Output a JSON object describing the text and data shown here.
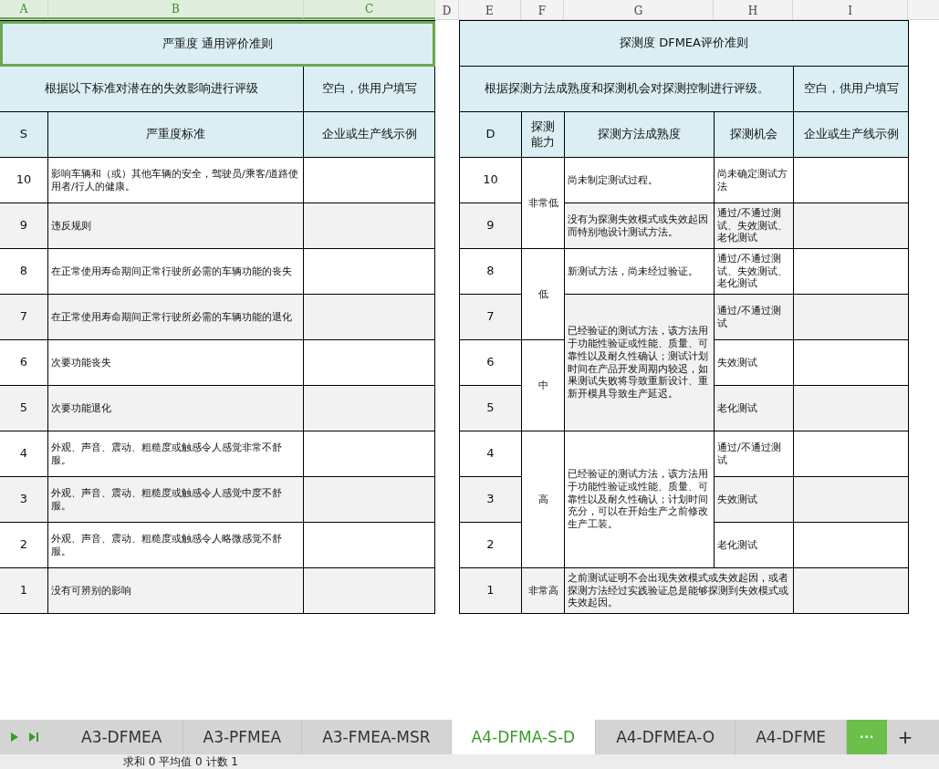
{
  "column_headers": [
    {
      "label": "A",
      "selected": true
    },
    {
      "label": "B",
      "selected": true
    },
    {
      "label": "C",
      "selected": true
    },
    {
      "label": "D",
      "selected": false
    },
    {
      "label": "E",
      "selected": false
    },
    {
      "label": "F",
      "selected": false
    },
    {
      "label": "G",
      "selected": false
    },
    {
      "label": "H",
      "selected": false
    },
    {
      "label": "I",
      "selected": false
    }
  ],
  "severity_table": {
    "title": "严重度 通用评价准则",
    "title_selected": true,
    "subtitle": "根据以下标准对潜在的失效影响进行评级",
    "note": "空白，供用户填写",
    "columns": [
      "S",
      "严重度标准",
      "企业或生产线示例"
    ],
    "rows": [
      {
        "s": "10",
        "criteria": "影响车辆和（或）其他车辆的安全，驾驶员/乘客/道路使用者/行人的健康。"
      },
      {
        "s": "9",
        "criteria": "违反规则"
      },
      {
        "s": "8",
        "criteria": "在正常使用寿命期间正常行驶所必需的车辆功能的丧失"
      },
      {
        "s": "7",
        "criteria": "在正常使用寿命期间正常行驶所必需的车辆功能的退化"
      },
      {
        "s": "6",
        "criteria": "次要功能丧失"
      },
      {
        "s": "5",
        "criteria": "次要功能退化"
      },
      {
        "s": "4",
        "criteria": "外观、声音、震动、粗糙度或触感令人感觉非常不舒服。"
      },
      {
        "s": "3",
        "criteria": "外观、声音、震动、粗糙度或触感令人感觉中度不舒服。"
      },
      {
        "s": "2",
        "criteria": "外观、声音、震动、粗糙度或触感令人略微感觉不舒服。"
      },
      {
        "s": "1",
        "criteria": "没有可辨别的影响"
      }
    ]
  },
  "detection_table": {
    "title": "探测度 DFMEA评价准则",
    "subtitle": "根据探测方法成熟度和探测机会对探测控制进行评级。",
    "note": "空白，供用户填写",
    "columns": [
      "D",
      "探测能力",
      "探测方法成熟度",
      "探测机会",
      "企业或生产线示例"
    ],
    "rows": [
      {
        "d": "10",
        "ability": "非常低",
        "maturity": "尚未制定测试过程。",
        "opportunity": "尚未确定测试方法"
      },
      {
        "d": "9",
        "maturity": "没有为探测失效模式或失效起因而特别地设计测试方法。",
        "opportunity": "通过/不通过测试、失效测试、老化测试"
      },
      {
        "d": "8",
        "ability": "低",
        "maturity": "新测试方法，尚未经过验证。",
        "opportunity": "通过/不通过测试、失效测试、老化测试"
      },
      {
        "d": "7",
        "maturity": "已经验证的测试方法，该方法用于功能性验证或性能、质量、可靠性以及耐久性确认；测试计划时间在产品开发周期内较迟，如果测试失败将导致重新设计、重新开模具导致生产延迟。",
        "opportunity": "通过/不通过测试"
      },
      {
        "d": "6",
        "ability": "中",
        "opportunity": "失效测试"
      },
      {
        "d": "5",
        "opportunity": "老化测试"
      },
      {
        "d": "4",
        "ability": "高",
        "maturity": "已经验证的测试方法，该方法用于功能性验证或性能、质量、可靠性以及耐久性确认；计划时间充分，可以在开始生产之前修改生产工装。",
        "opportunity": "通过/不通过测试"
      },
      {
        "d": "3",
        "opportunity": "失效测试"
      },
      {
        "d": "2",
        "opportunity": "老化测试"
      },
      {
        "d": "1",
        "ability": "非常高",
        "maturity": "之前测试证明不会出现失效模式或失效起因，或者探测方法经过实践验证总是能够探测到失效模式或失效起因。"
      }
    ]
  },
  "sheet_tabs": [
    {
      "label": "A3-DFMEA",
      "selected": false
    },
    {
      "label": "A3-PFMEA",
      "selected": false
    },
    {
      "label": "A3-FMEA-MSR",
      "selected": false
    },
    {
      "label": "A4-DFMA-S-D",
      "selected": true
    },
    {
      "label": "A4-DFMEA-O",
      "selected": false
    },
    {
      "label": "A4-DFME",
      "selected": false
    }
  ],
  "more_tabs": "···",
  "add_sheet": "+",
  "status_bar": "求和 0 平均值 0 计数 1"
}
